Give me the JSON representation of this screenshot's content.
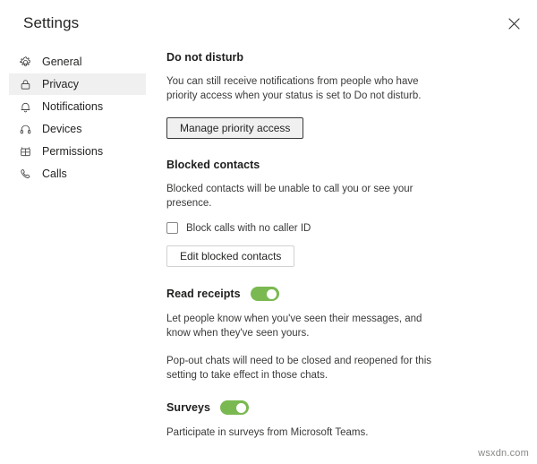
{
  "window": {
    "title": "Settings",
    "close_label": "Close"
  },
  "sidebar": {
    "items": [
      {
        "label": "General",
        "icon": "gear-icon",
        "selected": false
      },
      {
        "label": "Privacy",
        "icon": "lock-icon",
        "selected": true
      },
      {
        "label": "Notifications",
        "icon": "bell-icon",
        "selected": false
      },
      {
        "label": "Devices",
        "icon": "headset-icon",
        "selected": false
      },
      {
        "label": "Permissions",
        "icon": "apps-grid-icon",
        "selected": false
      },
      {
        "label": "Calls",
        "icon": "phone-icon",
        "selected": false
      }
    ]
  },
  "content": {
    "do_not_disturb": {
      "heading": "Do not disturb",
      "description": "You can still receive notifications from people who have priority access when your status is set to Do not disturb.",
      "button_label": "Manage priority access"
    },
    "blocked_contacts": {
      "heading": "Blocked contacts",
      "description": "Blocked contacts will be unable to call you or see your presence.",
      "checkbox_label": "Block calls with no caller ID",
      "checkbox_checked": false,
      "button_label": "Edit blocked contacts"
    },
    "read_receipts": {
      "heading": "Read receipts",
      "toggle_on": true,
      "description_1": "Let people know when you've seen their messages, and know when they've seen yours.",
      "description_2": "Pop-out chats will need to be closed and reopened for this setting to take effect in those chats."
    },
    "surveys": {
      "heading": "Surveys",
      "toggle_on": true,
      "description": "Participate in surveys from Microsoft Teams."
    }
  },
  "watermark": "wsxdn.com",
  "colors": {
    "toggle_on": "#7ab951",
    "selected_row": "#f0f0f0",
    "text_primary": "#201f1e",
    "text_secondary": "#3b3a39"
  }
}
